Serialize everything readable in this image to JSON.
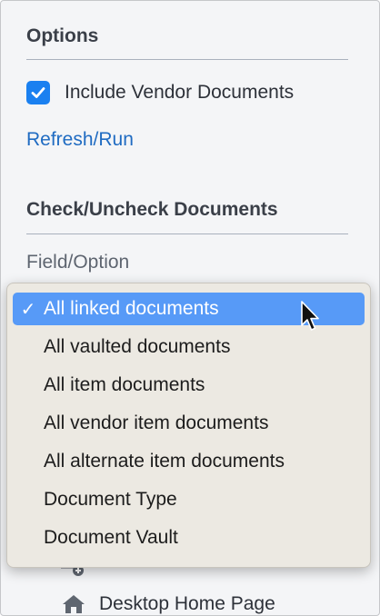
{
  "options": {
    "title": "Options",
    "include_vendor_docs": {
      "label": "Include Vendor Documents",
      "checked": true
    },
    "refresh_link": "Refresh/Run"
  },
  "check_section": {
    "title": "Check/Uncheck Documents",
    "field_label": "Field/Option"
  },
  "dropdown": {
    "selected_index": 0,
    "options": [
      "All linked documents",
      "All vaulted documents",
      "All item documents",
      "All vendor item documents",
      "All alternate item documents",
      "Document Type",
      "Document Vault"
    ]
  },
  "behind": {
    "desktop_home": "Desktop Home Page"
  },
  "colors": {
    "accent": "#1a80f0",
    "link": "#1f6bc2",
    "selection": "#579af7"
  },
  "icons": [
    "checkmark-icon",
    "list-add-icon",
    "home-icon",
    "mouse-pointer-icon"
  ]
}
